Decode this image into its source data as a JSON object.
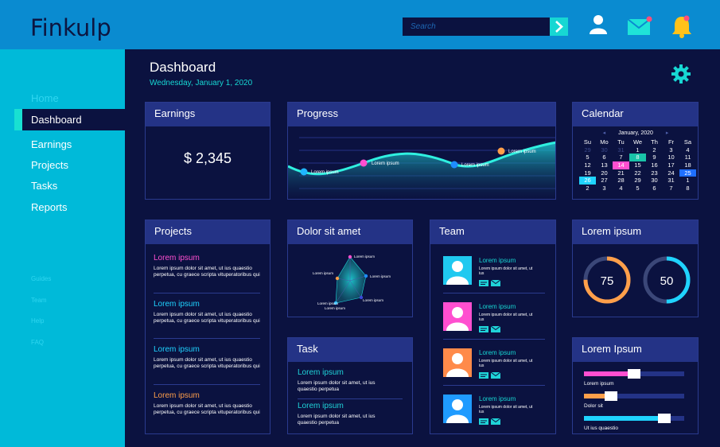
{
  "app": {
    "title": "Finkulp"
  },
  "search": {
    "placeholder": "Search"
  },
  "topbar_icons": [
    "user-icon",
    "mail-icon",
    "bell-icon"
  ],
  "sidebar": {
    "items": [
      {
        "label": "Home"
      },
      {
        "label": "Dashboard"
      },
      {
        "label": "Earnings"
      },
      {
        "label": "Projects"
      },
      {
        "label": "Tasks"
      },
      {
        "label": "Reports"
      },
      {
        "label": "Guides"
      },
      {
        "label": "Team"
      },
      {
        "label": "Help"
      },
      {
        "label": "FAQ"
      }
    ],
    "active": "Dashboard"
  },
  "page": {
    "title": "Dashboard",
    "date": "Wednesday, January 1, 2020"
  },
  "earnings": {
    "title": "Earnings",
    "value": "$ 2,345"
  },
  "progress": {
    "title": "Progress",
    "points": [
      "Lorem ipsum",
      "Lorem ipsum",
      "Lorem ipsum",
      "Lorem ipsum"
    ],
    "point_colors": [
      "#1fb6ff",
      "#ff4fd0",
      "#1f8dff",
      "#ff9f4a"
    ]
  },
  "calendar": {
    "title": "Calendar",
    "month": "January, 2020",
    "weekdays": [
      "Su",
      "Mo",
      "Tu",
      "We",
      "Th",
      "Fr",
      "Sa"
    ],
    "days": [
      "29",
      "30",
      "31",
      "1",
      "2",
      "3",
      "4",
      "5",
      "6",
      "7",
      "8",
      "9",
      "10",
      "11",
      "12",
      "13",
      "14",
      "15",
      "16",
      "17",
      "18",
      "19",
      "20",
      "21",
      "22",
      "23",
      "24",
      "25",
      "26",
      "27",
      "28",
      "29",
      "30",
      "31",
      "1",
      "2",
      "3",
      "4",
      "5",
      "6",
      "7",
      "8"
    ]
  },
  "projects": {
    "title": "Projects",
    "items": [
      {
        "title": "Lorem ipsum",
        "color": "#ff4fd0",
        "desc": "Lorem ipsum dolor sit amet, ut ius quaestio perpetua, cu graece scripta vituperatoribus qui"
      },
      {
        "title": "Lorem ipsum",
        "color": "#1fd3ff",
        "desc": "Lorem ipsum dolor sit amet, ut ius quaestio perpetua, cu graece scripta vituperatoribus qui"
      },
      {
        "title": "Lorem ipsum",
        "color": "#1fd3ff",
        "desc": "Lorem ipsum dolor sit amet, ut ius quaestio perpetua, cu graece scripta vituperatoribus qui"
      },
      {
        "title": "Lorem ipsum",
        "color": "#ff9f4a",
        "desc": "Lorem ipsum dolor sit amet, ut ius quaestio perpetua, cu graece scripta vituperatoribus qui"
      }
    ]
  },
  "radar": {
    "title": "Dolor sit amet",
    "labels": [
      "Lorem ipsum",
      "Lorem ipsum",
      "Lorem ipsum",
      "Lorem ipsum",
      "Lorem ipsum",
      "Lorem ipsum"
    ]
  },
  "task": {
    "title": "Task",
    "items": [
      {
        "title": "Lorem ipsum",
        "desc": "Lorem ipsum dolor sit amet, ut ius quaestio perpetua"
      },
      {
        "title": "Lorem ipsum",
        "desc": "Lorem ipsum dolor sit amet, ut ius quaestio perpetua"
      }
    ]
  },
  "team": {
    "title": "Team",
    "members": [
      {
        "name": "Lorem ipsum",
        "desc": "Lorem ipsum dolor sit amet, ut ius",
        "color": "#1fc9f0"
      },
      {
        "name": "Lorem ipsum",
        "desc": "Lorem ipsum dolor sit amet, ut ius",
        "color": "#ff4fd0"
      },
      {
        "name": "Lorem ipsum",
        "desc": "Lorem ipsum dolor sit amet, ut ius",
        "color": "#ff8a4a"
      },
      {
        "name": "Lorem ipsum",
        "desc": "Lorem ipsum dolor sit amet, ut ius",
        "color": "#1f9bff"
      }
    ]
  },
  "gauges": {
    "title": "Lorem ipsum",
    "items": [
      {
        "value": "75",
        "fraction": 0.75,
        "color": "#ff9f4a"
      },
      {
        "value": "50",
        "fraction": 0.5,
        "color": "#1fd3ff"
      }
    ]
  },
  "sliders": {
    "title": "Lorem Ipsum",
    "items": [
      {
        "label": "Lorem ipsum",
        "fraction": 0.5,
        "color": "#ff4fd0"
      },
      {
        "label": "Dolor sit",
        "fraction": 0.27,
        "color": "#ff9f4a"
      },
      {
        "label": "Ut ius quaestio",
        "fraction": 0.8,
        "color": "#1fd3ff"
      }
    ]
  }
}
